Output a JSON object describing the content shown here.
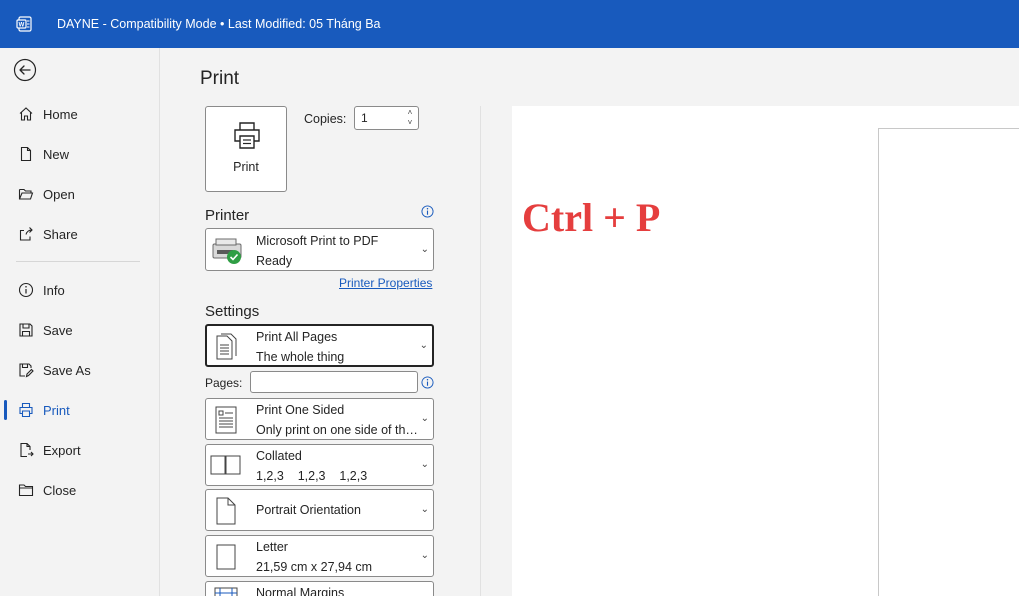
{
  "window": {
    "title": "DAYNE  -  Compatibility Mode • Last Modified: 05 Tháng Ba",
    "accent_color": "#185abd",
    "app_icon": "word-icon"
  },
  "nav": {
    "back_icon": "back-arrow-icon",
    "items": [
      {
        "label": "Home",
        "icon": "home-icon"
      },
      {
        "label": "New",
        "icon": "new-document-icon"
      },
      {
        "label": "Open",
        "icon": "open-folder-icon"
      },
      {
        "label": "Share",
        "icon": "share-icon"
      },
      {
        "label": "Info",
        "icon": "info-icon"
      },
      {
        "label": "Save",
        "icon": "save-icon"
      },
      {
        "label": "Save As",
        "icon": "save-as-icon"
      },
      {
        "label": "Print",
        "icon": "print-icon",
        "active": true
      },
      {
        "label": "Export",
        "icon": "export-icon"
      },
      {
        "label": "Close",
        "icon": "close-folder-icon"
      }
    ]
  },
  "print": {
    "title": "Print",
    "print_button_label": "Print",
    "copies_label": "Copies:",
    "copies_value": "1",
    "printer_section": "Printer",
    "printer_name": "Microsoft Print to PDF",
    "printer_status": "Ready",
    "printer_properties_link": "Printer Properties",
    "settings_section": "Settings",
    "settings": {
      "range_title": "Print All Pages",
      "range_sub": "The whole thing",
      "pages_label": "Pages:",
      "pages_value": "",
      "sides_title": "Print One Sided",
      "sides_sub": "Only print on one side of the...",
      "collation_title": "Collated",
      "collation_sub": "1,2,3    1,2,3    1,2,3",
      "orientation_title": "Portrait Orientation",
      "paper_title": "Letter",
      "paper_sub": "21,59 cm x 27,94 cm",
      "margins_title": "Normal Margins"
    }
  },
  "preview": {
    "overlay_text": "Ctrl + P",
    "overlay_color": "#e53e3e"
  }
}
